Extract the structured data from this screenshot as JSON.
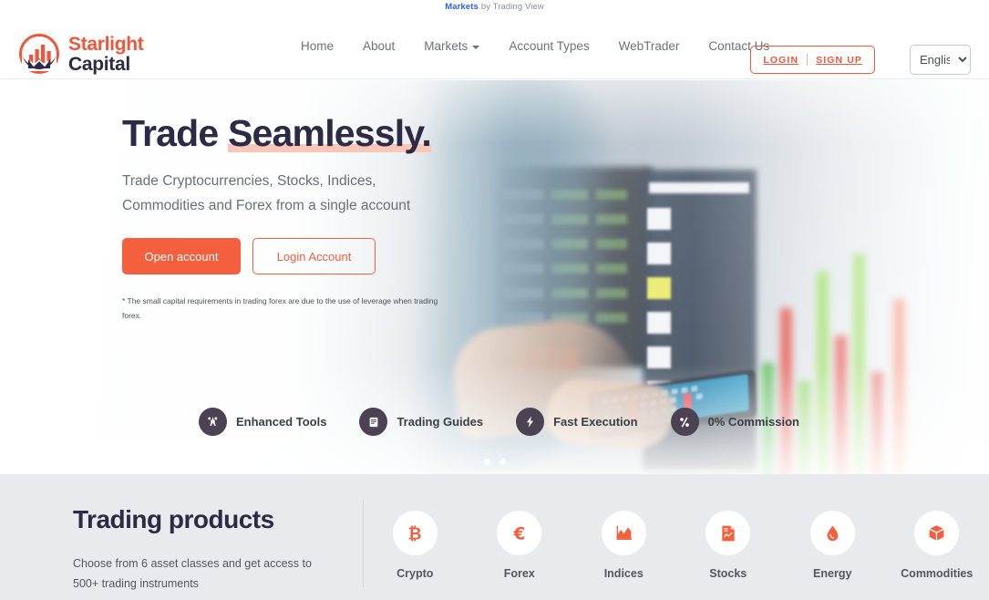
{
  "ticker": {
    "markets": "Markets",
    "by": "by Trading View"
  },
  "brand": {
    "line1": "Starlight",
    "line2": "Capital",
    "logo_icon": "bar-chart-circle-logo-icon",
    "color_orange": "#f0563a",
    "color_navy": "#2d2a45"
  },
  "nav": {
    "items": [
      {
        "label": "Home",
        "has_caret": false
      },
      {
        "label": "About",
        "has_caret": false
      },
      {
        "label": "Markets",
        "has_caret": true
      },
      {
        "label": "Account Types",
        "has_caret": false
      },
      {
        "label": "WebTrader",
        "has_caret": false
      },
      {
        "label": "Contact Us",
        "has_caret": false
      }
    ]
  },
  "auth": {
    "login": "LOGIN",
    "signup": "SIGN UP"
  },
  "language": {
    "selected": "English",
    "options": [
      "English"
    ]
  },
  "hero": {
    "title_part1": "Trade ",
    "title_highlight": "Seamlessly.",
    "subtitle_line1": "Trade Cryptocurrencies, Stocks, Indices,",
    "subtitle_line2": "Commodities and Forex from a single account",
    "primary_button": "Open account",
    "outline_button": "Login Account",
    "disclaimer": "* The small capital requirements in trading forex are due to the use of leverage when trading forex.",
    "features": [
      {
        "label": "Enhanced Tools",
        "icon": "tools-icon"
      },
      {
        "label": "Trading Guides",
        "icon": "book-icon"
      },
      {
        "label": "Fast Execution",
        "icon": "lightning-bolt-icon"
      },
      {
        "label": "0% Commission",
        "icon": "percent-icon"
      }
    ],
    "carousel_dots": 2,
    "active_dot": 0
  },
  "products": {
    "title": "Trading products",
    "description_line1": "Choose from 6 asset classes and get access to",
    "description_line2": "500+ trading instruments",
    "items": [
      {
        "label": "Crypto",
        "icon": "bitcoin-icon"
      },
      {
        "label": "Forex",
        "icon": "euro-icon"
      },
      {
        "label": "Indices",
        "icon": "area-chart-icon"
      },
      {
        "label": "Stocks",
        "icon": "document-chart-icon"
      },
      {
        "label": "Energy",
        "icon": "droplet-icon"
      },
      {
        "label": "Commodities",
        "icon": "box-icon"
      }
    ]
  },
  "colors": {
    "accent": "#f4603e",
    "navy": "#2d2a45",
    "products_bg": "#e9eaee",
    "feature_circle": "#4b4354"
  }
}
